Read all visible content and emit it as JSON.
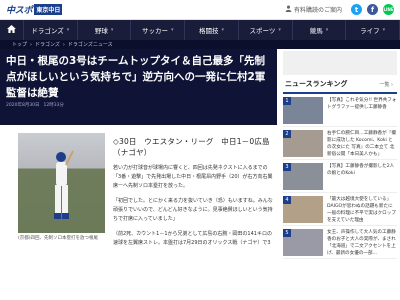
{
  "header": {
    "logo_main": "中スポ",
    "logo_sub": "東京中日",
    "register_label": "有料購読のご案内",
    "sns": [
      {
        "icon": "twitter-icon",
        "glyph": "t"
      },
      {
        "icon": "facebook-icon",
        "glyph": "f"
      },
      {
        "icon": "line-icon",
        "glyph": "LINE"
      }
    ]
  },
  "nav": {
    "home_icon": "home-icon",
    "items": [
      {
        "label": "ドラゴンズ"
      },
      {
        "label": "野球"
      },
      {
        "label": "サッカー"
      },
      {
        "label": "格闘技"
      },
      {
        "label": "スポーツ"
      },
      {
        "label": "競馬"
      },
      {
        "label": "ライフ"
      }
    ]
  },
  "breadcrumb": {
    "items": [
      "トップ",
      "ドラゴンズ",
      "ドラゴンズニュース"
    ],
    "separator": "›"
  },
  "article": {
    "headline": "中日・根尾の3号はチームトップタイ＆自己最多「先制点がほしいという気持ちで」逆方向への一発に仁村2軍監督は絶賛",
    "date": "2020年8月30日",
    "time": "12時33分",
    "caption": "(京都)四回、先制ソロ本塁打を放つ根尾",
    "game_line": "◇30日　ウエスタン・リーグ　中日1－0広島（ナゴヤ）",
    "paragraphs": [
      "若い力が打球音が球場内に響くと、四回は先発ネクストに入るまでの「3番・遊撃」で先発出場した中日・根尾昂内野手（20）が右方向右翼席ーへ先制ソロ本塁打を放った。",
      "「初回でした。とにかく来る力を抜いていき（恐）もいますね。みんな頑張りでいいので、どんどん好きなように。見事絶賛ほしいという気持ちで打席に入っていました」",
      "（前2死、カウント1－1から兄弟として広島の右腕・岡田の141キロの速球を左翼席ストレ。本盤打は7月29日のオリックス戦（ナゴヤ）で3"
    ]
  },
  "sidebar": {
    "ranking_title": "ニュースランキング",
    "more_label": "一覧 ›",
    "items": [
      {
        "rank": "1",
        "text": "【写真】これぞ気分!! 世界共フォトグラファー提供し工藤静香"
      },
      {
        "rank": "2",
        "text": "右手仁の腕仁目…工藤静香が『撮影に成功した Kocomi、Koki との次女にた 写真』の二本立て 北新宿公開「本日美人かも」"
      },
      {
        "rank": "3",
        "text": "【写真】工藤静香が撮影した2人の娘とのKoki"
      },
      {
        "rank": "4",
        "text": "「最大は越境大使をしている」DAIGOが思わぬの話題も新たに一般の料理に不平で実はクロップを支えていた理由"
      },
      {
        "rank": "5",
        "text": "女王、声操作して大人気の工藤静香のお子と大人の実際が、まされ「北海道」で二文アクセントを上げ、最新の女優の一部…"
      }
    ]
  }
}
